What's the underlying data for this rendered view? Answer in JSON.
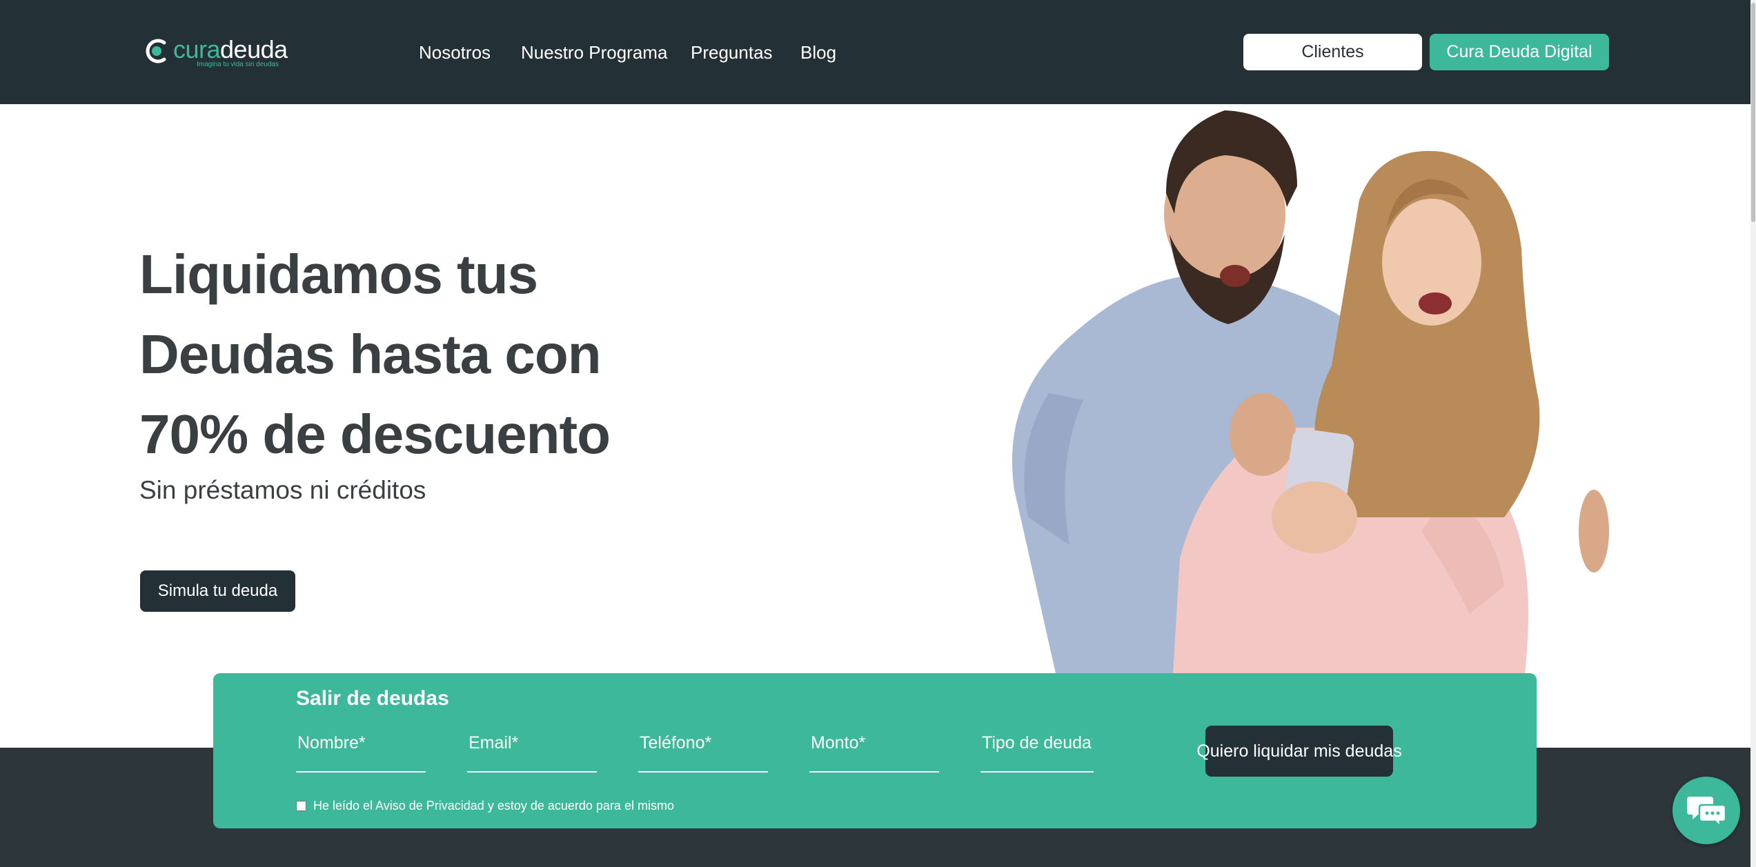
{
  "header": {
    "logo": {
      "brand_part1": "cura",
      "brand_part2": "deuda",
      "tagline": "Imagina tu vida sin deudas"
    },
    "nav": [
      {
        "label": "Nosotros"
      },
      {
        "label": "Nuestro Programa"
      },
      {
        "label": "Preguntas"
      },
      {
        "label": "Blog"
      }
    ],
    "clientes_label": "Clientes",
    "digital_label": "Cura Deuda Digital"
  },
  "hero": {
    "title_lines": [
      "Liquidamos tus",
      "Deudas hasta con",
      "70% de descuento"
    ],
    "subtitle": "Sin préstamos ni créditos",
    "cta_label": "Simula tu deuda",
    "image": "couple-looking-at-phone"
  },
  "form": {
    "title": "Salir de deudas",
    "fields": [
      {
        "placeholder": "Nombre*",
        "value": ""
      },
      {
        "placeholder": "Email*",
        "value": ""
      },
      {
        "placeholder": "Teléfono*",
        "value": ""
      },
      {
        "placeholder": "Monto*",
        "value": ""
      },
      {
        "placeholder": "Tipo de deuda*",
        "value": ""
      }
    ],
    "submit_label": "Quiero liquidar mis deudas",
    "consent_label": "He leído el Aviso de Privacidad y estoy de acuerdo para el mismo",
    "consent_checked": false
  },
  "chat": {
    "icon": "chat-bubbles-icon"
  },
  "colors": {
    "header_bg": "#233036",
    "accent": "#3db89a",
    "text_dark": "#3a3f42",
    "band_bg": "#2c363b"
  }
}
